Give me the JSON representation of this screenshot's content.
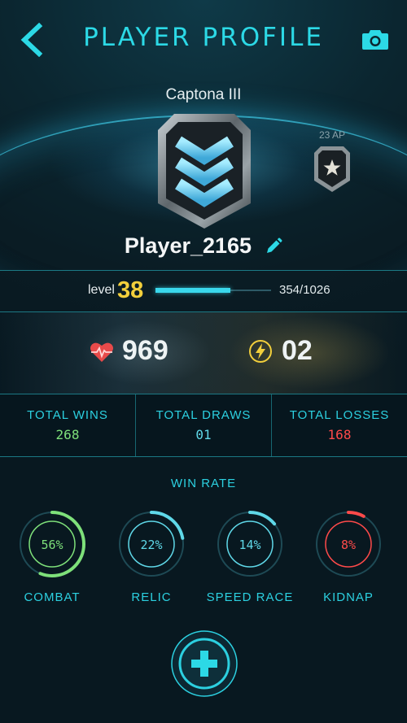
{
  "header": {
    "title": "PLAYER PROFILE",
    "back_icon": "chevron-left-icon",
    "camera_icon": "camera-icon",
    "accent_color": "#2cd9e6"
  },
  "profile": {
    "rank_name": "Captona III",
    "rank_icon": "chevron-rank-badge",
    "ap_label": "23 AP",
    "ap_icon": "star-badge-icon",
    "player_name": "Player_2165",
    "edit_icon": "pencil-icon"
  },
  "level": {
    "label": "level",
    "value": "38",
    "xp_text": "354/1026",
    "xp_fraction": 0.65,
    "value_color": "#f2cf3c"
  },
  "resources": {
    "health_icon": "heart-icon",
    "health_value": "969",
    "energy_icon": "lightning-icon",
    "energy_value": "02"
  },
  "stats": [
    {
      "label": "TOTAL WINS",
      "value": "268",
      "color": "#7ee07a"
    },
    {
      "label": "TOTAL DRAWS",
      "value": "01",
      "color": "#5fd8e8"
    },
    {
      "label": "TOTAL LOSSES",
      "value": "168",
      "color": "#ff4a4a"
    }
  ],
  "win_rate": {
    "title": "WIN RATE",
    "items": [
      {
        "label": "COMBAT",
        "value": "56%",
        "fraction": 0.56,
        "color": "#7ee07a"
      },
      {
        "label": "RELIC",
        "value": "22%",
        "fraction": 0.22,
        "color": "#5fd8e8"
      },
      {
        "label": "SPEED RACE",
        "value": "14%",
        "fraction": 0.14,
        "color": "#5fd8e8"
      },
      {
        "label": "KIDNAP",
        "value": "8%",
        "fraction": 0.08,
        "color": "#ff4a4a"
      }
    ]
  },
  "footer": {
    "add_icon": "plus-icon"
  }
}
